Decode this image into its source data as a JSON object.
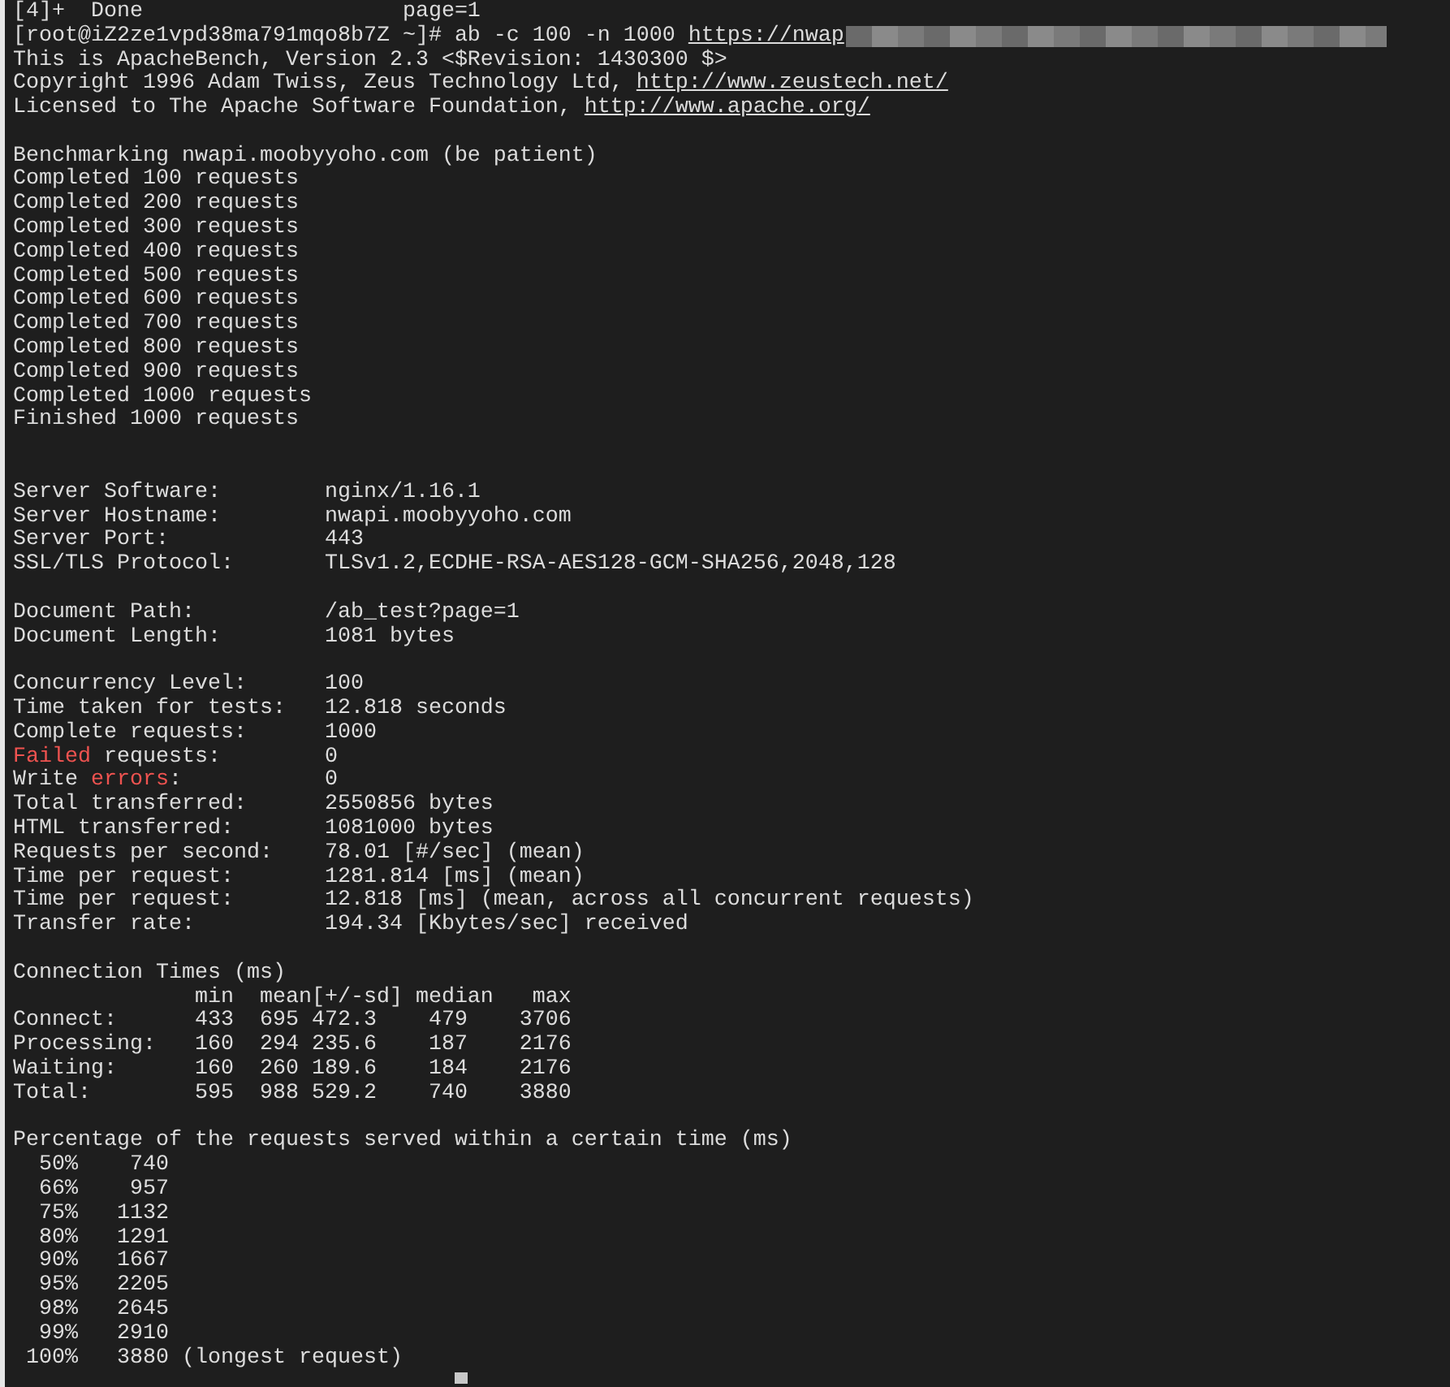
{
  "terminal": {
    "lines": [
      {
        "kind": "text",
        "parts": [
          {
            "kind": "plain",
            "text": "[4]+  Done                    page=1"
          }
        ]
      },
      {
        "kind": "text",
        "parts": [
          {
            "kind": "plain",
            "text": "[root@iZ2ze1vpd38ma791mqo8b7Z ~]# ab -c 100 -n 1000 "
          },
          {
            "kind": "link",
            "text": "https://nwap"
          }
        ],
        "redacted": true
      },
      {
        "kind": "text",
        "parts": [
          {
            "kind": "plain",
            "text": "This is ApacheBench, Version 2.3 <$Revision: 1430300 $>"
          }
        ]
      },
      {
        "kind": "text",
        "parts": [
          {
            "kind": "plain",
            "text": "Copyright 1996 Adam Twiss, Zeus Technology Ltd, "
          },
          {
            "kind": "link",
            "text": "http://www.zeustech.net/"
          }
        ]
      },
      {
        "kind": "text",
        "parts": [
          {
            "kind": "plain",
            "text": "Licensed to The Apache Software Foundation, "
          },
          {
            "kind": "link",
            "text": "http://www.apache.org/"
          }
        ]
      },
      {
        "kind": "blank"
      },
      {
        "kind": "text",
        "parts": [
          {
            "kind": "plain",
            "text": "Benchmarking nwapi.moobyyoho.com (be patient)"
          }
        ]
      },
      {
        "kind": "text",
        "parts": [
          {
            "kind": "plain",
            "text": "Completed 100 requests"
          }
        ]
      },
      {
        "kind": "text",
        "parts": [
          {
            "kind": "plain",
            "text": "Completed 200 requests"
          }
        ]
      },
      {
        "kind": "text",
        "parts": [
          {
            "kind": "plain",
            "text": "Completed 300 requests"
          }
        ]
      },
      {
        "kind": "text",
        "parts": [
          {
            "kind": "plain",
            "text": "Completed 400 requests"
          }
        ]
      },
      {
        "kind": "text",
        "parts": [
          {
            "kind": "plain",
            "text": "Completed 500 requests"
          }
        ]
      },
      {
        "kind": "text",
        "parts": [
          {
            "kind": "plain",
            "text": "Completed 600 requests"
          }
        ]
      },
      {
        "kind": "text",
        "parts": [
          {
            "kind": "plain",
            "text": "Completed 700 requests"
          }
        ]
      },
      {
        "kind": "text",
        "parts": [
          {
            "kind": "plain",
            "text": "Completed 800 requests"
          }
        ]
      },
      {
        "kind": "text",
        "parts": [
          {
            "kind": "plain",
            "text": "Completed 900 requests"
          }
        ]
      },
      {
        "kind": "text",
        "parts": [
          {
            "kind": "plain",
            "text": "Completed 1000 requests"
          }
        ]
      },
      {
        "kind": "text",
        "parts": [
          {
            "kind": "plain",
            "text": "Finished 1000 requests"
          }
        ]
      },
      {
        "kind": "blank"
      },
      {
        "kind": "blank"
      },
      {
        "kind": "text",
        "parts": [
          {
            "kind": "plain",
            "text": "Server Software:        nginx/1.16.1"
          }
        ]
      },
      {
        "kind": "text",
        "parts": [
          {
            "kind": "plain",
            "text": "Server Hostname:        nwapi.moobyyoho.com"
          }
        ]
      },
      {
        "kind": "text",
        "parts": [
          {
            "kind": "plain",
            "text": "Server Port:            443"
          }
        ]
      },
      {
        "kind": "text",
        "parts": [
          {
            "kind": "plain",
            "text": "SSL/TLS Protocol:       TLSv1.2,ECDHE-RSA-AES128-GCM-SHA256,2048,128"
          }
        ]
      },
      {
        "kind": "blank"
      },
      {
        "kind": "text",
        "parts": [
          {
            "kind": "plain",
            "text": "Document Path:          /ab_test?page=1"
          }
        ]
      },
      {
        "kind": "text",
        "parts": [
          {
            "kind": "plain",
            "text": "Document Length:        1081 bytes"
          }
        ]
      },
      {
        "kind": "blank"
      },
      {
        "kind": "text",
        "parts": [
          {
            "kind": "plain",
            "text": "Concurrency Level:      100"
          }
        ]
      },
      {
        "kind": "text",
        "parts": [
          {
            "kind": "plain",
            "text": "Time taken for tests:   12.818 seconds"
          }
        ]
      },
      {
        "kind": "text",
        "parts": [
          {
            "kind": "plain",
            "text": "Complete requests:      1000"
          }
        ]
      },
      {
        "kind": "text",
        "parts": [
          {
            "kind": "error",
            "text": "Failed"
          },
          {
            "kind": "plain",
            "text": " requests:        0"
          }
        ]
      },
      {
        "kind": "text",
        "parts": [
          {
            "kind": "plain",
            "text": "Write "
          },
          {
            "kind": "error",
            "text": "errors"
          },
          {
            "kind": "plain",
            "text": ":           0"
          }
        ]
      },
      {
        "kind": "text",
        "parts": [
          {
            "kind": "plain",
            "text": "Total transferred:      2550856 bytes"
          }
        ]
      },
      {
        "kind": "text",
        "parts": [
          {
            "kind": "plain",
            "text": "HTML transferred:       1081000 bytes"
          }
        ]
      },
      {
        "kind": "text",
        "parts": [
          {
            "kind": "plain",
            "text": "Requests per second:    78.01 [#/sec] (mean)"
          }
        ]
      },
      {
        "kind": "text",
        "parts": [
          {
            "kind": "plain",
            "text": "Time per request:       1281.814 [ms] (mean)"
          }
        ]
      },
      {
        "kind": "text",
        "parts": [
          {
            "kind": "plain",
            "text": "Time per request:       12.818 [ms] (mean, across all concurrent requests)"
          }
        ]
      },
      {
        "kind": "text",
        "parts": [
          {
            "kind": "plain",
            "text": "Transfer rate:          194.34 [Kbytes/sec] received"
          }
        ]
      },
      {
        "kind": "blank"
      },
      {
        "kind": "text",
        "parts": [
          {
            "kind": "plain",
            "text": "Connection Times (ms)"
          }
        ]
      },
      {
        "kind": "text",
        "parts": [
          {
            "kind": "plain",
            "text": "              min  mean[+/-sd] median   max"
          }
        ]
      },
      {
        "kind": "text",
        "parts": [
          {
            "kind": "plain",
            "text": "Connect:      433  695 472.3    479    3706"
          }
        ]
      },
      {
        "kind": "text",
        "parts": [
          {
            "kind": "plain",
            "text": "Processing:   160  294 235.6    187    2176"
          }
        ]
      },
      {
        "kind": "text",
        "parts": [
          {
            "kind": "plain",
            "text": "Waiting:      160  260 189.6    184    2176"
          }
        ]
      },
      {
        "kind": "text",
        "parts": [
          {
            "kind": "plain",
            "text": "Total:        595  988 529.2    740    3880"
          }
        ]
      },
      {
        "kind": "blank"
      },
      {
        "kind": "text",
        "parts": [
          {
            "kind": "plain",
            "text": "Percentage of the requests served within a certain time (ms)"
          }
        ]
      },
      {
        "kind": "text",
        "parts": [
          {
            "kind": "plain",
            "text": "  50%    740"
          }
        ]
      },
      {
        "kind": "text",
        "parts": [
          {
            "kind": "plain",
            "text": "  66%    957"
          }
        ]
      },
      {
        "kind": "text",
        "parts": [
          {
            "kind": "plain",
            "text": "  75%   1132"
          }
        ]
      },
      {
        "kind": "text",
        "parts": [
          {
            "kind": "plain",
            "text": "  80%   1291"
          }
        ]
      },
      {
        "kind": "text",
        "parts": [
          {
            "kind": "plain",
            "text": "  90%   1667"
          }
        ]
      },
      {
        "kind": "text",
        "parts": [
          {
            "kind": "plain",
            "text": "  95%   2205"
          }
        ]
      },
      {
        "kind": "text",
        "parts": [
          {
            "kind": "plain",
            "text": "  98%   2645"
          }
        ]
      },
      {
        "kind": "text",
        "parts": [
          {
            "kind": "plain",
            "text": "  99%   2910"
          }
        ]
      },
      {
        "kind": "text",
        "parts": [
          {
            "kind": "plain",
            "text": " 100%   3880 (longest request)"
          }
        ]
      },
      {
        "kind": "prompt",
        "cursor": true
      }
    ]
  }
}
